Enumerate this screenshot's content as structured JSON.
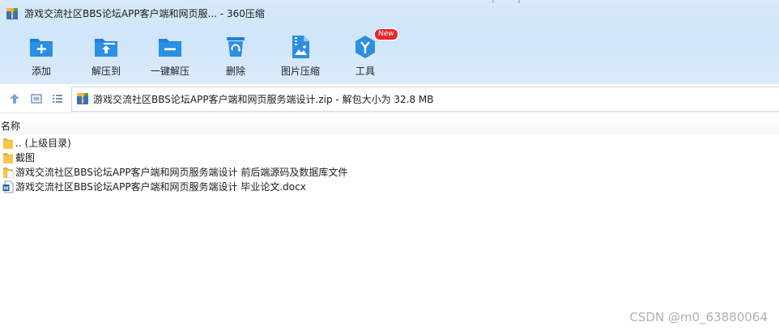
{
  "window": {
    "title": "游戏交流社区BBS论坛APP客户端和网页服... - 360压缩"
  },
  "toolbar": {
    "items": [
      {
        "label": "添加",
        "icon": "add-plus-icon"
      },
      {
        "label": "解压到",
        "icon": "extract-to-icon"
      },
      {
        "label": "一键解压",
        "icon": "one-click-extract-icon"
      },
      {
        "label": "删除",
        "icon": "recycle-bin-icon"
      },
      {
        "label": "图片压缩",
        "icon": "image-compress-icon"
      },
      {
        "label": "工具",
        "icon": "tools-icon",
        "badge": "New"
      }
    ]
  },
  "address": {
    "text": "游戏交流社区BBS论坛APP客户端和网页服务端设计.zip - 解包大小为 32.8 MB"
  },
  "file_list": {
    "column_name": "名称",
    "rows": [
      {
        "name": ".. (上级目录)",
        "type": "folder-up"
      },
      {
        "name": "截图",
        "type": "folder"
      },
      {
        "name": "游戏交流社区BBS论坛APP客户端和网页服务端设计 前后端源码及数据库文件",
        "type": "folder-file"
      },
      {
        "name": "游戏交流社区BBS论坛APP客户端和网页服务端设计 毕业论文.docx",
        "type": "word-doc"
      }
    ]
  },
  "watermark": "CSDN @m0_63880064",
  "colors": {
    "header_bg": "#d4e8fb",
    "icon_blue": "#1b7fd6",
    "badge_red": "#e8252c",
    "folder_yellow": "#f8c64a"
  }
}
